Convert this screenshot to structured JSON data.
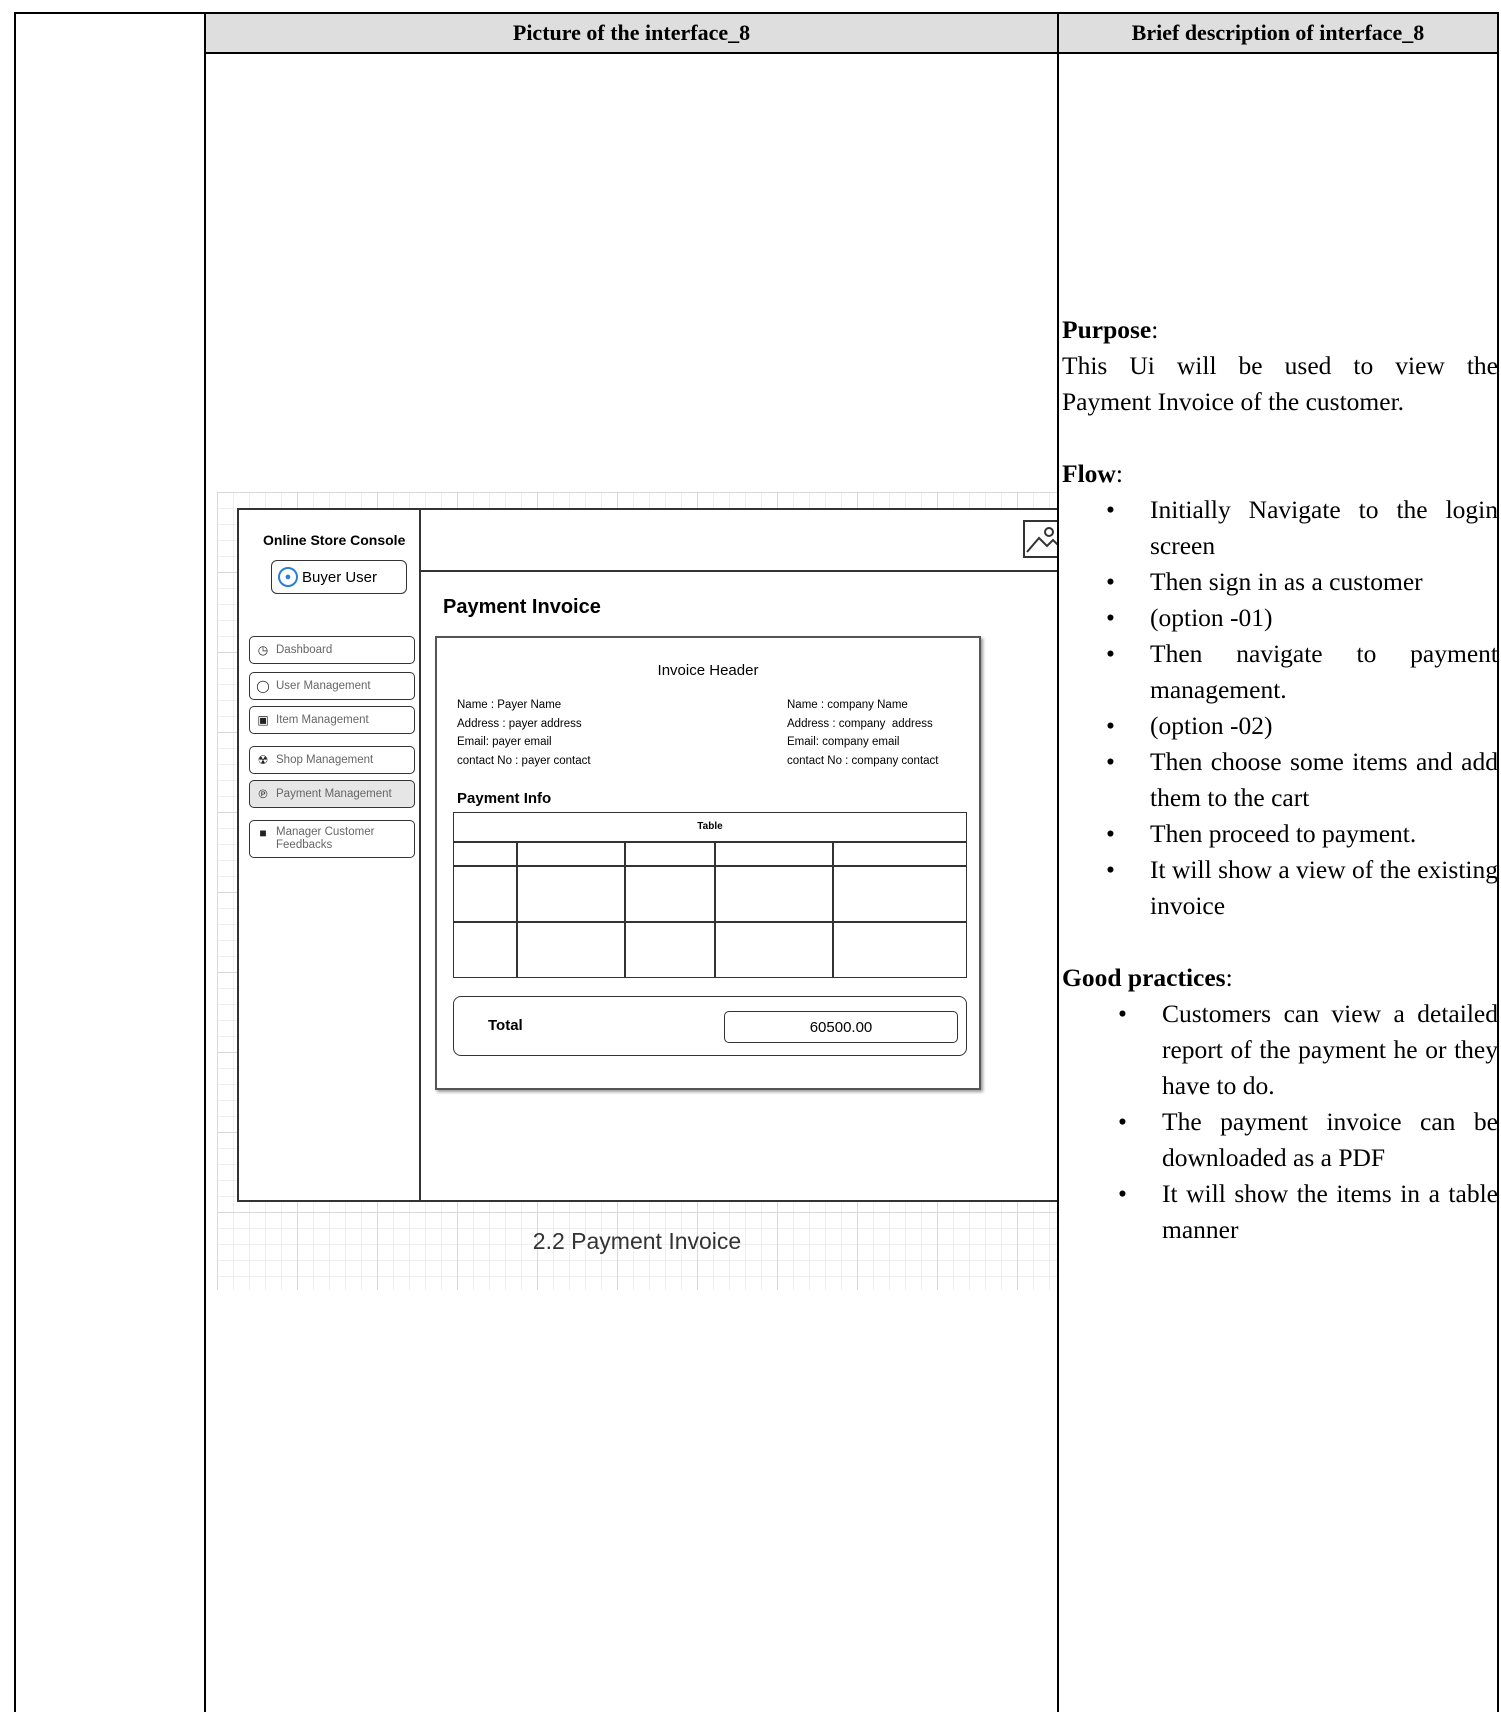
{
  "table_header": {
    "col1": "Picture of the interface_8",
    "col2": "Brief description of interface_8"
  },
  "mockup": {
    "console_title": "Online Store Console",
    "user_button": "Buyer User",
    "nav": [
      {
        "label": "Dashboard",
        "icon": "dashboard-gauge-icon"
      },
      {
        "label": "User Management",
        "icon": "user-icon"
      },
      {
        "label": "Item Management",
        "icon": "item-icon"
      },
      {
        "label": "Shop Management",
        "icon": "cart-icon"
      },
      {
        "label": "Payment Management",
        "icon": "payment-icon"
      },
      {
        "label": "Manager Customer Feedbacks",
        "icon": "feedback-icon"
      }
    ],
    "active_nav": "Payment Management",
    "page_title": "Payment Invoice",
    "invoice_header": "Invoice Header",
    "payer": {
      "name": "Name : Payer Name",
      "address": "Address : payer address",
      "email": "Email: payer email",
      "contact": "contact No : payer contact"
    },
    "company": {
      "name": "Name : company Name",
      "address": "Address : company  address",
      "email": "Email: company email",
      "contact": "contact No : company contact"
    },
    "payment_info_label": "Payment Info",
    "table_caption": "Table",
    "total_label": "Total",
    "total_value": "60500.00",
    "caption": "2.2 Payment Invoice"
  },
  "description": {
    "purpose_title": "Purpose",
    "purpose_line1": "This Ui will be used to view the",
    "purpose_line2": "Payment Invoice of the customer.",
    "flow_title": "Flow",
    "flow_items": [
      "Initially Navigate to the login screen",
      "Then sign in as a customer",
      "(option -01)",
      "Then navigate to payment management.",
      "(option -02)",
      "Then choose some items and add them to the cart",
      "Then proceed to payment.",
      "It will show a view of the existing invoice"
    ],
    "practices_title": "Good practices",
    "practices_items": [
      "Customers can view a detailed report of the payment he or they have to do.",
      "The payment invoice can be downloaded as a PDF",
      "It will show the items in a table manner"
    ]
  }
}
